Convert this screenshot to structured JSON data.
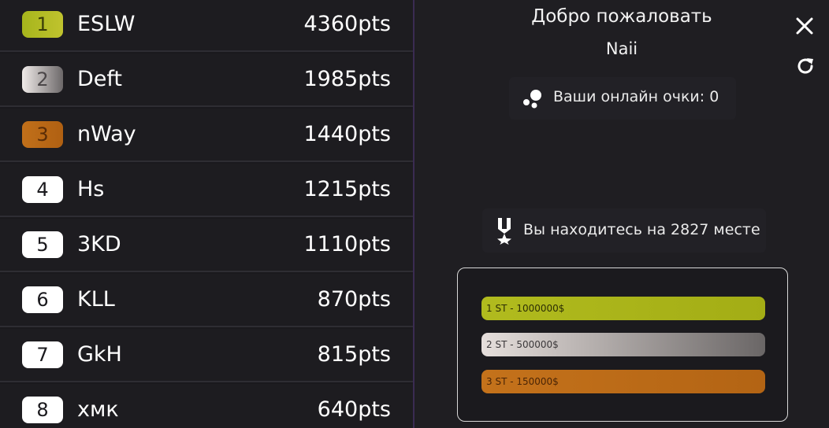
{
  "leaderboard": {
    "rows": [
      {
        "rank": "1",
        "name": "ESLW",
        "points": "4360pts",
        "tier": "gold"
      },
      {
        "rank": "2",
        "name": "Deft",
        "points": "1985pts",
        "tier": "silver"
      },
      {
        "rank": "3",
        "name": "nWay",
        "points": "1440pts",
        "tier": "bronze"
      },
      {
        "rank": "4",
        "name": "Hs",
        "points": "1215pts",
        "tier": "plain"
      },
      {
        "rank": "5",
        "name": "3KD",
        "points": "1110pts",
        "tier": "plain"
      },
      {
        "rank": "6",
        "name": "KLL",
        "points": "870pts",
        "tier": "plain"
      },
      {
        "rank": "7",
        "name": "GkH",
        "points": "815pts",
        "tier": "plain"
      },
      {
        "rank": "8",
        "name": "xмк",
        "points": "640pts",
        "tier": "plain"
      }
    ]
  },
  "panel": {
    "welcome": "Добро пожаловать",
    "username": "Naii",
    "online_points": "Ваши онлайн очки: 0",
    "place": "Вы находитесь на 2827 месте",
    "prizes": [
      {
        "label": "1 ST - 1000000$",
        "tier": "gold"
      },
      {
        "label": "2 ST - 500000$",
        "tier": "silver"
      },
      {
        "label": "3 ST - 150000$",
        "tier": "bronze"
      }
    ],
    "icons": {
      "close": "close-icon",
      "refresh": "refresh-icon",
      "online": "online-points-icon",
      "medal": "medal-icon"
    }
  },
  "colors": {
    "gold": "#a6b51c",
    "silver": "#d9d3d1",
    "bronze": "#c1701a",
    "accent_divider": "#3a2b52"
  }
}
